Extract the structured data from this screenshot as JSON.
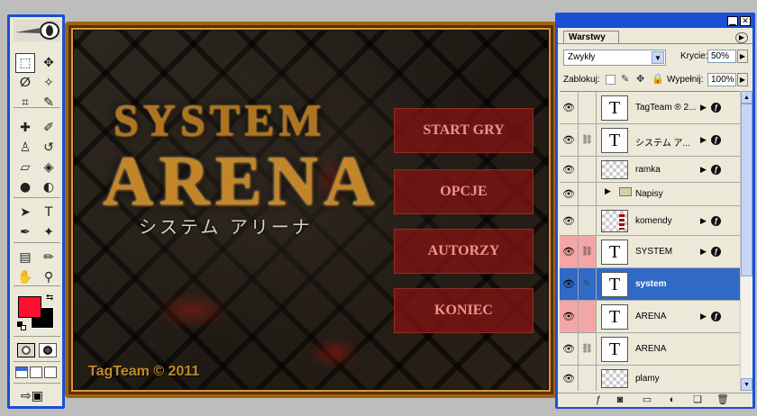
{
  "toolbox": {
    "logo": "photoshop-feather-logo",
    "tools": [
      {
        "name": "marquee-tool",
        "glyph": "⬚"
      },
      {
        "name": "move-tool",
        "glyph": "✥"
      },
      {
        "name": "lasso-tool",
        "glyph": "ⵁ"
      },
      {
        "name": "magic-wand-tool",
        "glyph": "✧"
      },
      {
        "name": "crop-tool",
        "glyph": "⌗"
      },
      {
        "name": "slice-tool",
        "glyph": "✎"
      },
      {
        "name": "healing-brush-tool",
        "glyph": "✚"
      },
      {
        "name": "brush-tool",
        "glyph": "✐"
      },
      {
        "name": "clone-stamp-tool",
        "glyph": "♙"
      },
      {
        "name": "history-brush-tool",
        "glyph": "↺"
      },
      {
        "name": "eraser-tool",
        "glyph": "▱"
      },
      {
        "name": "paint-bucket-tool",
        "glyph": "◈"
      },
      {
        "name": "blur-tool",
        "glyph": "●"
      },
      {
        "name": "dodge-tool",
        "glyph": "◐"
      },
      {
        "name": "path-selection-tool",
        "glyph": "➤"
      },
      {
        "name": "type-tool",
        "glyph": "T"
      },
      {
        "name": "pen-tool",
        "glyph": "✒"
      },
      {
        "name": "shape-tool",
        "glyph": "✦"
      },
      {
        "name": "notes-tool",
        "glyph": "▤"
      },
      {
        "name": "eyedropper-tool",
        "glyph": "✏"
      },
      {
        "name": "hand-tool",
        "glyph": "✋"
      },
      {
        "name": "zoom-tool",
        "glyph": "⚲"
      }
    ],
    "foreground_color": "#ff1030",
    "background_color": "#000000"
  },
  "canvas": {
    "title_line1": "SYSTEM",
    "title_line2": "ARENA",
    "title_japanese": "システム アリーナ",
    "menu": [
      "START GRY",
      "OPCJE",
      "AUTORZY",
      "KONIEC"
    ],
    "footer": "TagTeam © 2011",
    "accent_color": "#c28629",
    "button_color": "#801414"
  },
  "panel": {
    "tab_label": "Warstwy",
    "blend_mode": "Zwykły",
    "opacity_label": "Krycie:",
    "opacity_value": "50%",
    "lock_label": "Zablokuj:",
    "fill_label": "Wypełnij:",
    "fill_value": "100%",
    "layers": [
      {
        "name": "TagTeam ® 2...",
        "type": "text",
        "fx": true,
        "highlight": false,
        "selected": false,
        "link": false
      },
      {
        "name": "システム ア...",
        "type": "text",
        "fx": true,
        "highlight": false,
        "selected": false,
        "link": true
      },
      {
        "name": "ramka",
        "type": "image",
        "fx": true,
        "highlight": false,
        "selected": false,
        "link": false
      },
      {
        "name": "Napisy",
        "type": "folder",
        "fx": false,
        "highlight": false,
        "selected": false,
        "link": false
      },
      {
        "name": "komendy",
        "type": "image-red",
        "fx": true,
        "highlight": false,
        "selected": false,
        "link": false
      },
      {
        "name": "SYSTEM",
        "type": "text",
        "fx": true,
        "highlight": true,
        "selected": false,
        "link": true
      },
      {
        "name": "system",
        "type": "text",
        "fx": false,
        "highlight": false,
        "selected": true,
        "link": false,
        "brush": true
      },
      {
        "name": "ARENA",
        "type": "text",
        "fx": true,
        "highlight": true,
        "selected": false,
        "link": false
      },
      {
        "name": "ARENA",
        "type": "text",
        "fx": false,
        "highlight": false,
        "selected": false,
        "link": true
      },
      {
        "name": "plamy",
        "type": "image",
        "fx": false,
        "highlight": false,
        "selected": false,
        "link": false
      }
    ]
  }
}
